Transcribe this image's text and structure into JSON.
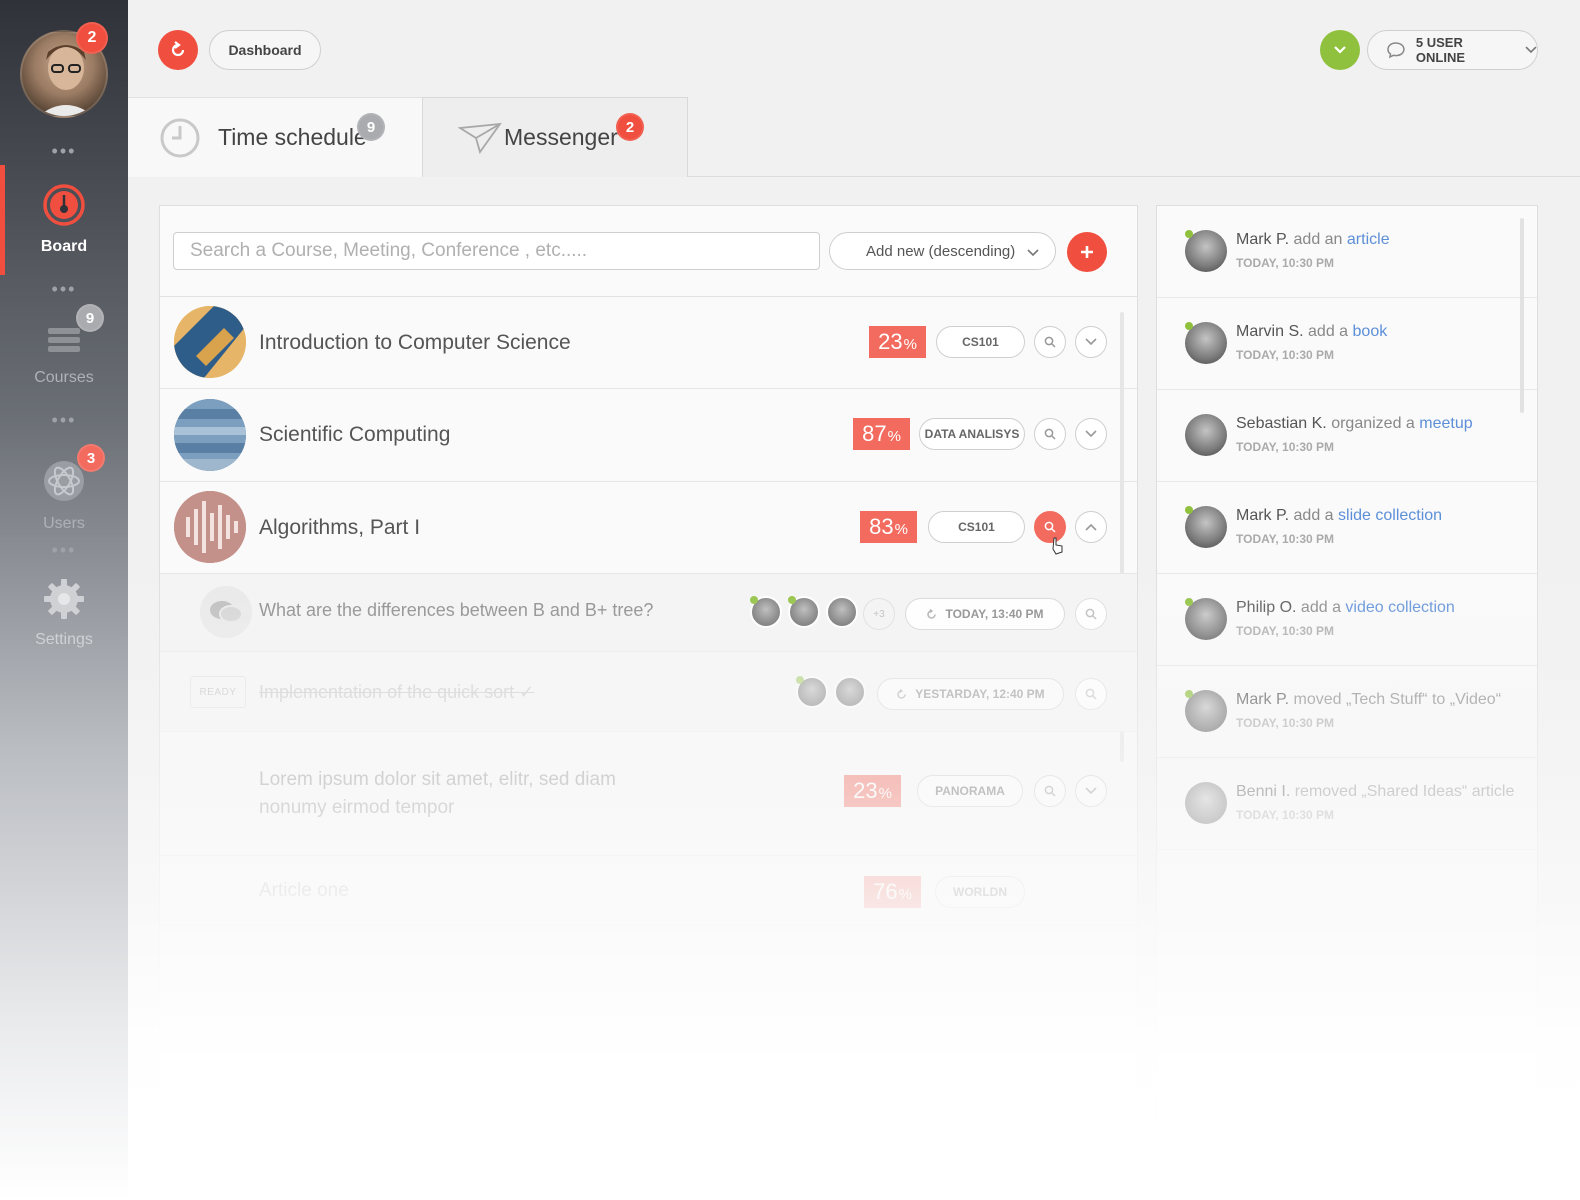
{
  "sidebar": {
    "avatar_badge": "2",
    "items": [
      {
        "label": "Board",
        "icon": "speedometer-icon",
        "badge": ""
      },
      {
        "label": "Courses",
        "icon": "stack-icon",
        "badge": "9"
      },
      {
        "label": "Users",
        "icon": "atom-icon",
        "badge": "3"
      },
      {
        "label": "Settings",
        "icon": "gear-icon",
        "badge": ""
      }
    ]
  },
  "topbar": {
    "breadcrumb": "Dashboard",
    "users_online": "5 USER ONLINE"
  },
  "tabs": [
    {
      "label": "Time schedule",
      "badge": "9",
      "icon": "clock-icon"
    },
    {
      "label": "Messenger",
      "badge": "2",
      "icon": "paper-plane-icon"
    }
  ],
  "search": {
    "placeholder": "Search a Course, Meeting, Conference , etc.....",
    "sort_label": "Add new (descending)"
  },
  "courses": [
    {
      "title": "Introduction to Computer Science",
      "pct": "23",
      "tag": "CS101"
    },
    {
      "title": "Scientific Computing",
      "pct": "87",
      "tag": "DATA ANALISYS"
    },
    {
      "title": "Algorithms, Part I",
      "pct": "83",
      "tag": "CS101"
    }
  ],
  "subitems": [
    {
      "title": "What are the differences between B and B+ tree?",
      "extra": "+3",
      "time": "TODAY, 13:40 PM"
    },
    {
      "status": "READY",
      "title": "Implementation of the quick sort",
      "time": "YESTARDAY, 12:40 PM"
    }
  ],
  "faded_rows": [
    {
      "title": "Lorem ipsum dolor sit amet, elitr, sed diam nonumy eirmod tempor",
      "pct": "23",
      "tag": "PANORAMA"
    },
    {
      "title": "Article one",
      "pct": "76",
      "tag": "WORLDN"
    }
  ],
  "activity": [
    {
      "who": "Mark P.",
      "action": "add an",
      "object": "article",
      "time": "TODAY, 10:30 PM"
    },
    {
      "who": "Marvin S.",
      "action": "add a",
      "object": "book",
      "time": "TODAY, 10:30 PM"
    },
    {
      "who": "Sebastian K.",
      "action": "organized a",
      "object": "meetup",
      "time": "TODAY, 10:30 PM"
    },
    {
      "who": "Mark P.",
      "action": "add a",
      "object": "slide collection",
      "time": "TODAY, 10:30 PM"
    },
    {
      "who": "Philip O.",
      "action": "add a",
      "object": "video collection",
      "time": "TODAY, 10:30 PM"
    },
    {
      "who": "Mark P.",
      "action": "moved „Tech Stuff“ to „Video“",
      "object": "",
      "time": "TODAY, 10:30 PM"
    },
    {
      "who": "Benni I.",
      "action": "removed „Shared Ideas“ article",
      "object": "",
      "time": "TODAY, 10:30 PM"
    }
  ],
  "colors": {
    "accent": "#f04e3e",
    "online": "#8fc13e",
    "link": "#5d8fd8"
  }
}
